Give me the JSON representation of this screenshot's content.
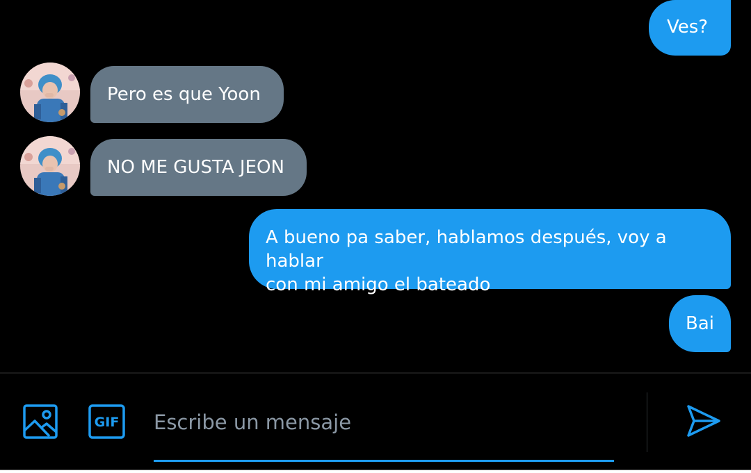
{
  "messages": [
    {
      "id": "ves",
      "direction": "outgoing",
      "text": "Ves?"
    },
    {
      "id": "pero",
      "direction": "incoming",
      "text": "Pero es que Yoon"
    },
    {
      "id": "nome",
      "direction": "incoming",
      "text": "NO ME GUSTA JEON"
    },
    {
      "id": "abueno",
      "direction": "outgoing",
      "text": "A bueno pa saber, hablamos después, voy a hablar\ncon mi amigo el bateado"
    },
    {
      "id": "bai",
      "direction": "outgoing",
      "text": "Bai"
    }
  ],
  "composer": {
    "placeholder": "Escribe un mensaje",
    "image_icon": "image-icon",
    "gif_label": "GIF",
    "send_icon": "send-icon"
  },
  "colors": {
    "outgoing_bubble": "#1d9bf0",
    "incoming_bubble": "#657786",
    "accent": "#1d9bf0",
    "background": "#000000"
  }
}
